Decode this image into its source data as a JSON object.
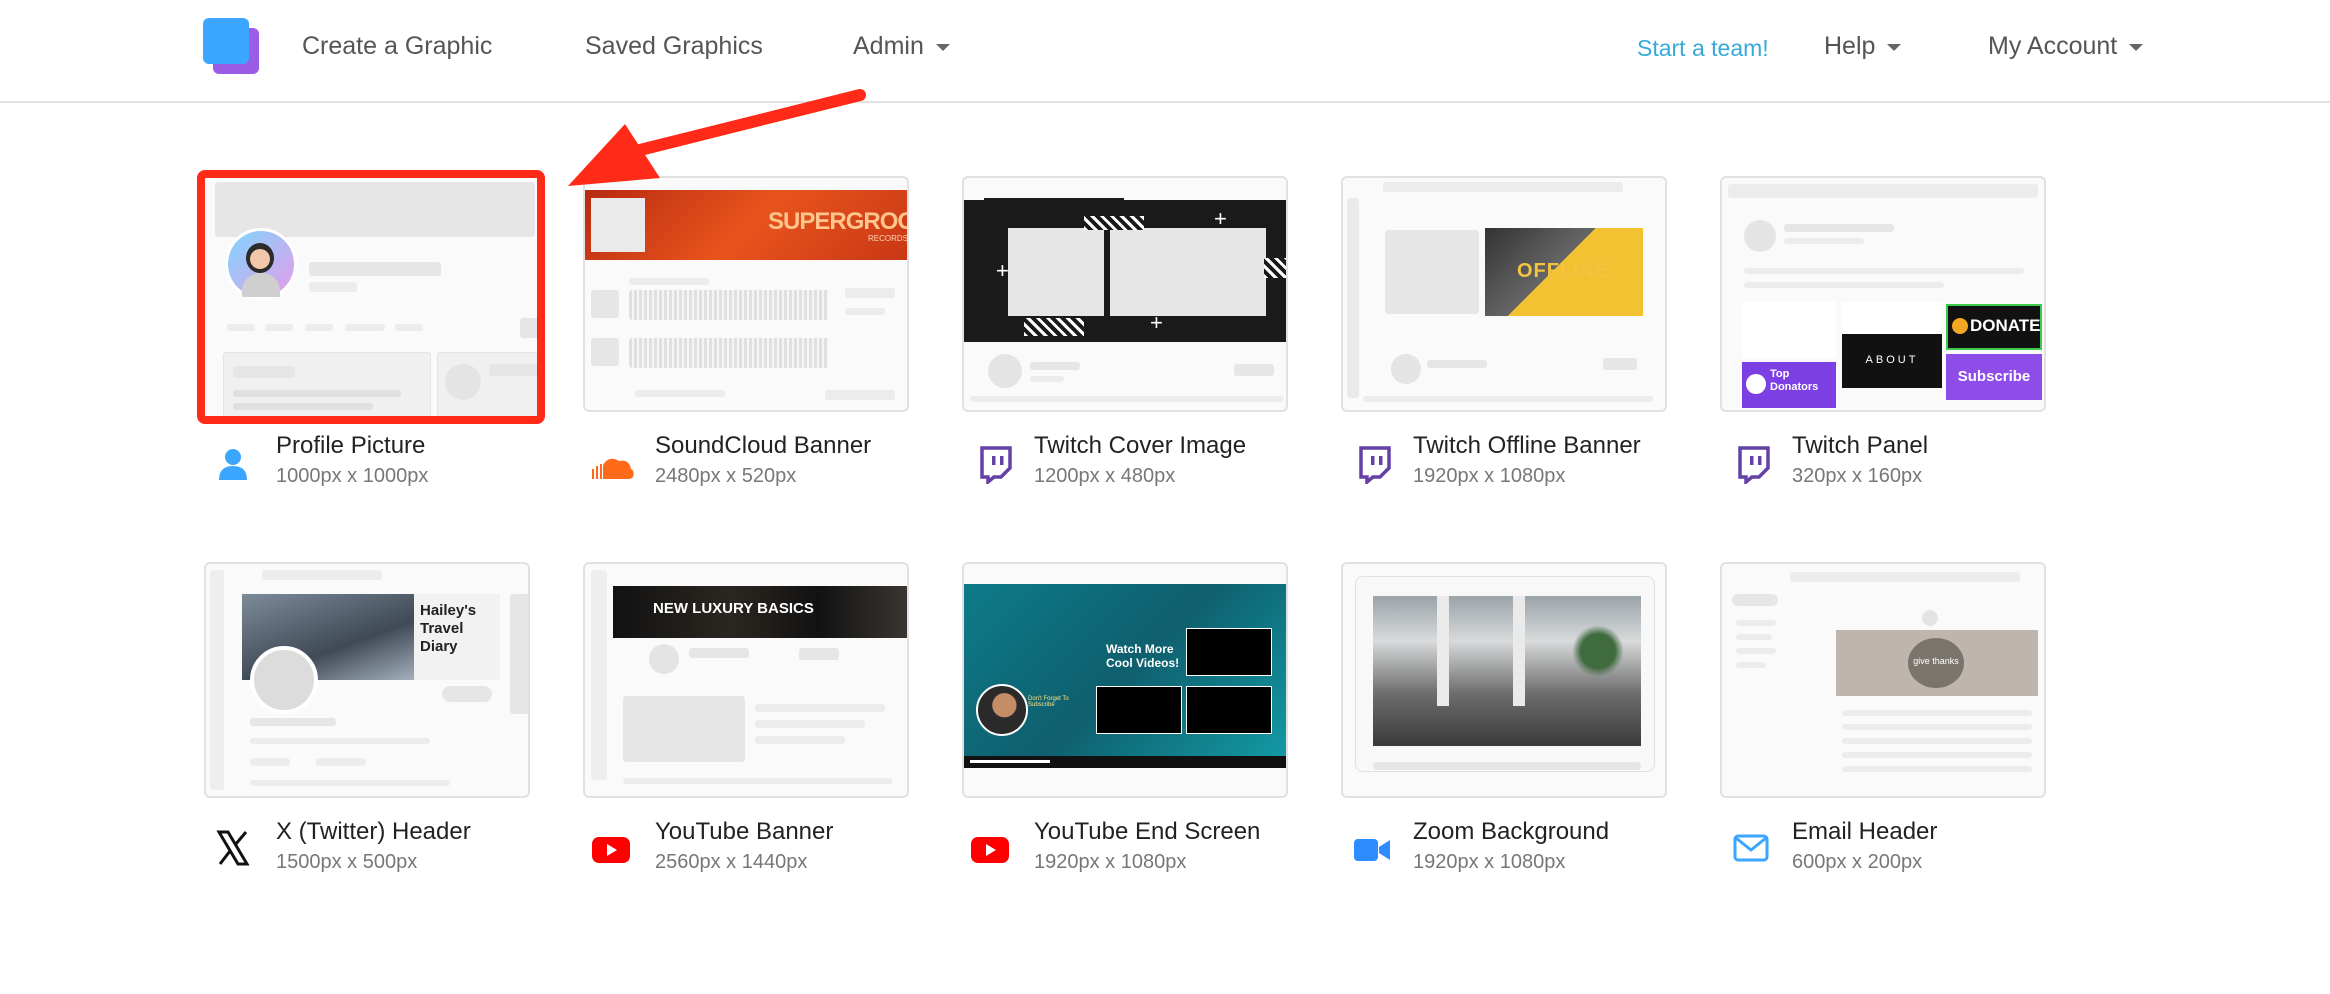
{
  "nav": {
    "create": "Create a Graphic",
    "saved": "Saved Graphics",
    "admin": "Admin",
    "team": "Start a team!",
    "help": "Help",
    "account": "My Account"
  },
  "cards": [
    {
      "title": "Profile Picture",
      "size": "1000px x 1000px",
      "icon": "user-icon"
    },
    {
      "title": "SoundCloud Banner",
      "size": "2480px x 520px",
      "icon": "soundcloud-icon"
    },
    {
      "title": "Twitch Cover Image",
      "size": "1200px x 480px",
      "icon": "twitch-icon"
    },
    {
      "title": "Twitch Offline Banner",
      "size": "1920px x 1080px",
      "icon": "twitch-icon"
    },
    {
      "title": "Twitch Panel",
      "size": "320px x 160px",
      "icon": "twitch-icon"
    },
    {
      "title": "X (Twitter) Header",
      "size": "1500px x 500px",
      "icon": "x-icon"
    },
    {
      "title": "YouTube Banner",
      "size": "2560px x 1440px",
      "icon": "youtube-icon"
    },
    {
      "title": "YouTube End Screen",
      "size": "1920px x 1080px",
      "icon": "youtube-icon"
    },
    {
      "title": "Zoom Background",
      "size": "1920px x 1080px",
      "icon": "zoom-video-icon"
    },
    {
      "title": "Email Header",
      "size": "600px x 200px",
      "icon": "email-icon"
    }
  ],
  "thumb_text": {
    "soundcloud": "SUPERGROOVE",
    "soundcloud_sub": "RECORDS",
    "offline": "OFFLINE",
    "donate": "DONATE",
    "about": "ABOUT",
    "top_donators": "Top Donators",
    "subscribe": "Subscribe",
    "travel": "Hailey's Travel Diary",
    "luxury": "NEW LUXURY BASICS",
    "watch_more": "Watch More Cool Videos!",
    "dont_forget": "Don't Forget To Subscribe",
    "give_thanks": "give thanks"
  },
  "colors": {
    "accent": "#36a9d8",
    "highlight": "#ff2a17",
    "twitch": "#6441a5",
    "youtube": "#ff0000",
    "soundcloud": "#ff6a1a",
    "zoom": "#2d8cff"
  }
}
